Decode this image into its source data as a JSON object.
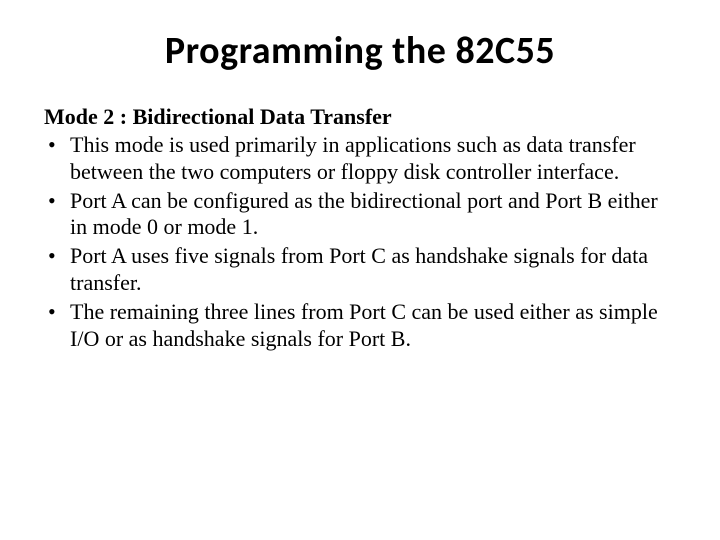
{
  "title": "Programming the 82C55",
  "subheading": "Mode 2 : Bidirectional Data Transfer",
  "bullets": [
    "This mode is used primarily in applications such as data transfer between the two computers or floppy disk controller interface.",
    "Port A can be configured as the bidirectional port and Port B either in mode 0 or mode 1.",
    "Port A uses five signals from Port C as handshake signals for data transfer.",
    "The remaining three lines from Port C can be used either as simple I/O or as handshake signals for Port B."
  ]
}
